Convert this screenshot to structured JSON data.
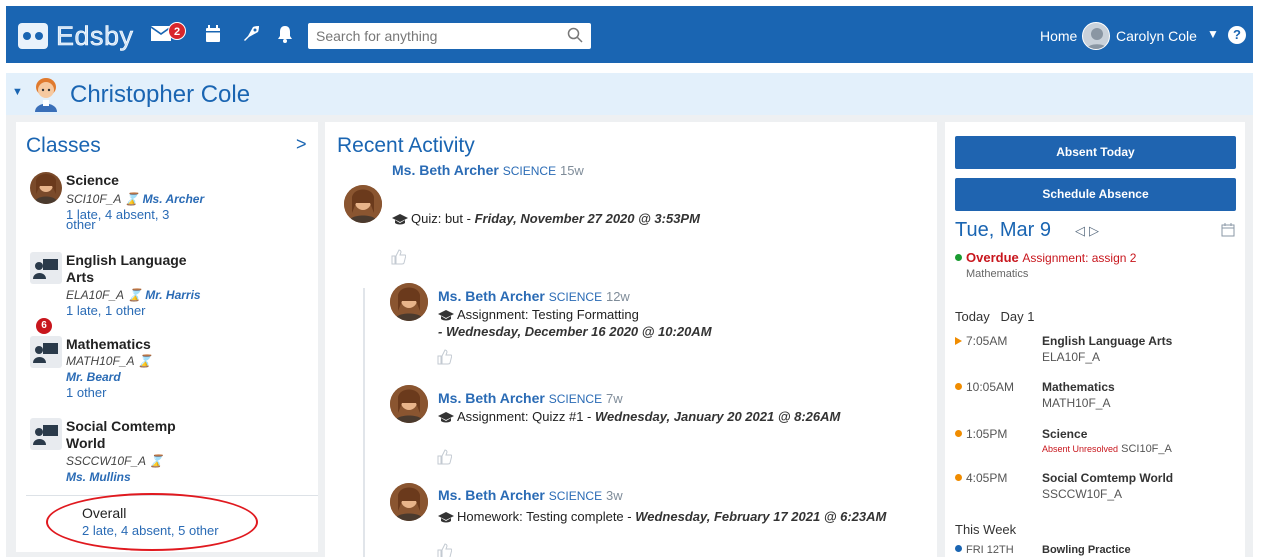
{
  "topbar": {
    "logo_text": "Edsby",
    "messages_badge": "2",
    "search_placeholder": "Search for anything",
    "home_label": "Home",
    "user_name": "Carolyn Cole",
    "help_label": "?"
  },
  "student": {
    "name": "Christopher Cole"
  },
  "classes": {
    "title": "Classes",
    "items": [
      {
        "name": "Science",
        "code": "SCI10F_A",
        "teacher": "Ms. Archer",
        "attendance_line1": "1 late, 4 absent, 3",
        "attendance_line2": "other",
        "badge": ""
      },
      {
        "name": "English Language Arts",
        "code": "ELA10F_A",
        "teacher": "Mr. Harris",
        "attendance_line1": "1 late, 1 other",
        "badge": "6"
      },
      {
        "name": "Mathematics",
        "code": "MATH10F_A",
        "teacher": "Mr. Beard",
        "attendance_line1": "1 other",
        "badge": ""
      },
      {
        "name": "Social Comtemp World",
        "code": "SSCCW10F_A",
        "teacher": "Ms. Mullins",
        "attendance_line1": "",
        "badge": ""
      }
    ],
    "overall_label": "Overall",
    "overall_value": "2 late, 4 absent, 5 other"
  },
  "recent": {
    "title": "Recent Activity",
    "items": [
      {
        "author": "Ms. Beth Archer",
        "course": "SCIENCE",
        "ago": "15w",
        "line1_prefix": "Quiz: but - ",
        "line1_date": "Friday, November 27 2020 @ 3:53PM"
      },
      {
        "author": "Ms. Beth Archer",
        "course": "SCIENCE",
        "ago": "12w",
        "line1_prefix": "Assignment: Testing Formatting",
        "line2_date": "- Wednesday, December 16 2020 @ 10:20AM"
      },
      {
        "author": "Ms. Beth Archer",
        "course": "SCIENCE",
        "ago": "7w",
        "line1_prefix": "Assignment: Quizz #1 - ",
        "line1_date": "Wednesday, January 20 2021 @ 8:26AM"
      },
      {
        "author": "Ms. Beth Archer",
        "course": "SCIENCE",
        "ago": "3w",
        "line1_prefix": "Homework: Testing complete - ",
        "line1_date": "Wednesday, February 17 2021 @ 6:23AM"
      }
    ]
  },
  "right": {
    "absent_today_label": "Absent Today",
    "schedule_absence_label": "Schedule Absence",
    "date_label": "Tue, Mar 9",
    "overdue_label": "Overdue",
    "overdue_item": "Assignment: assign 2",
    "overdue_class": "Mathematics",
    "today_label": "Today",
    "day_label": "Day 1",
    "schedule": [
      {
        "time": "7:05AM",
        "name": "English Language Arts",
        "code": "ELA10F_A"
      },
      {
        "time": "10:05AM",
        "name": "Mathematics",
        "code": "MATH10F_A"
      },
      {
        "time": "1:05PM",
        "name": "Science",
        "status": "Absent Unresolved",
        "code": "SCI10F_A"
      },
      {
        "time": "4:05PM",
        "name": "Social Comtemp World",
        "code": "SSCCW10F_A"
      }
    ],
    "this_week_label": "This Week",
    "week_item_date": "FRI 12TH",
    "week_item_name": "Bowling Practice"
  },
  "colors": {
    "brand": "#1a65b2",
    "overdue": "#c8161d",
    "annotation_circle": "#e0191f"
  }
}
